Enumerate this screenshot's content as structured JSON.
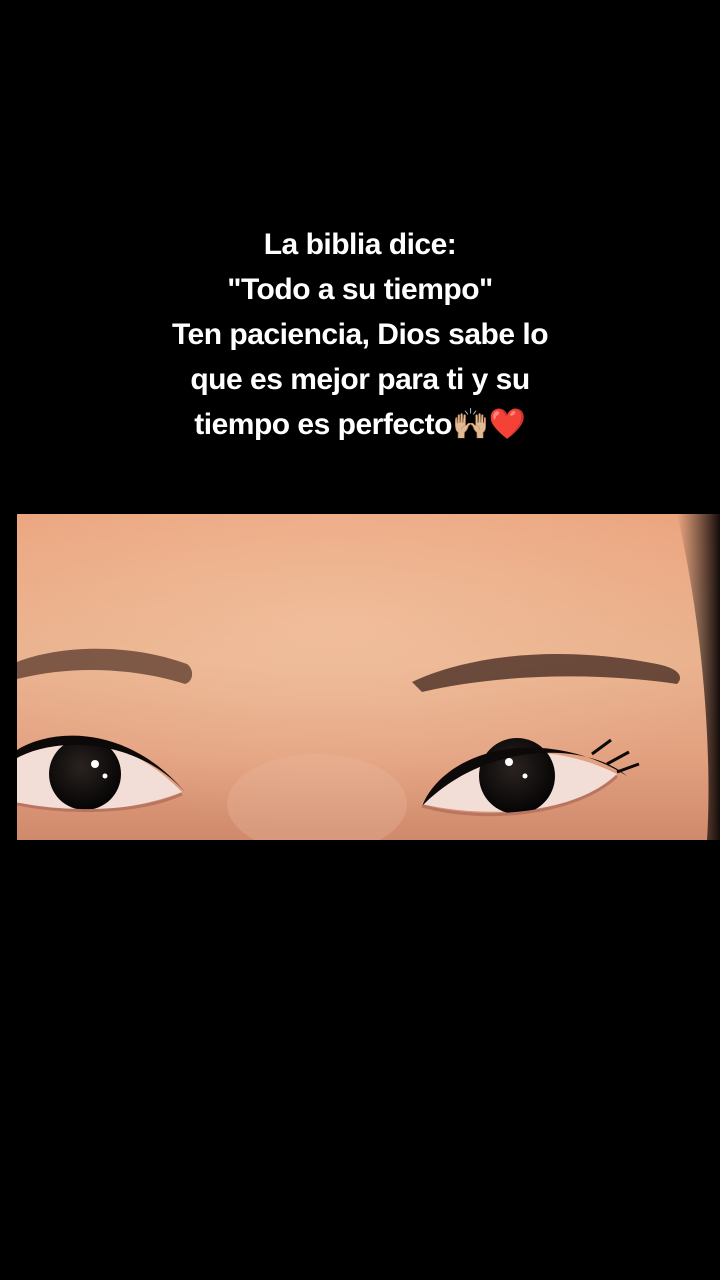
{
  "caption": {
    "line1": "La biblia dice:",
    "line2": "\"Todo a su tiempo\"",
    "line3": "Ten paciencia, Dios sabe lo",
    "line4": "que es mejor para ti y su",
    "line5": "tiempo es perfecto🙌🏼❤️"
  },
  "colors": {
    "background": "#000000",
    "text": "#ffffff",
    "skin": "#e6a07c"
  }
}
